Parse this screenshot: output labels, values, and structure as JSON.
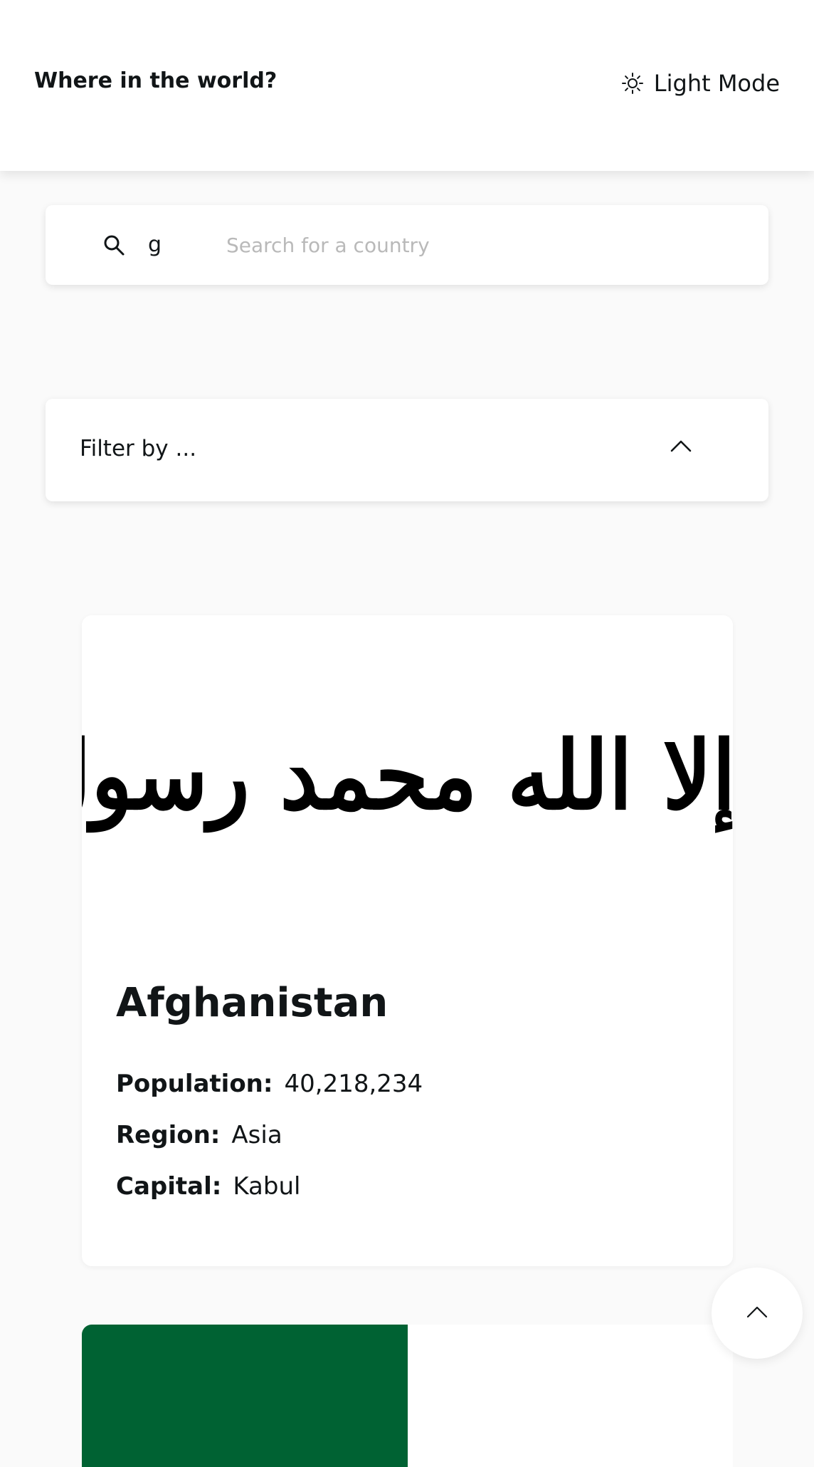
{
  "header": {
    "title": "Where in the world?",
    "theme_icon": "sun-icon",
    "theme_label": "Light Mode"
  },
  "search": {
    "icon": "search-icon",
    "typed_prefix": "g",
    "value": "",
    "placeholder": "Search for a country"
  },
  "filter": {
    "label": "Filter by ...",
    "icon": "chevron-up-icon"
  },
  "countries": [
    {
      "name": "Afghanistan",
      "flag_text": "لا إله إلا الله محمد رسول الله",
      "population_label": "Population:",
      "population": "40,218,234",
      "region_label": "Region:",
      "region": "Asia",
      "capital_label": "Capital:",
      "capital": "Kabul"
    },
    {
      "flag_colors": [
        "#006233",
        "#ffffff"
      ]
    }
  ],
  "scroll_top": {
    "icon": "chevron-up-icon"
  },
  "colors": {
    "background": "#fafafa",
    "surface": "#ffffff",
    "text": "#111517",
    "placeholder": "#b9b9b9"
  }
}
